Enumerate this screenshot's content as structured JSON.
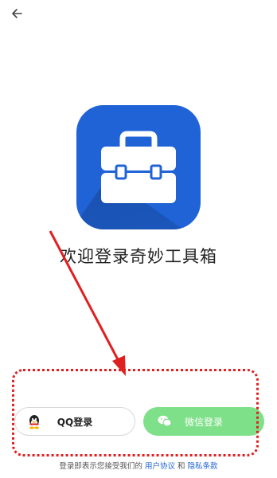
{
  "header": {
    "back_icon": "arrow-left-icon"
  },
  "app": {
    "icon": "toolbox-icon",
    "icon_bg": "#1f63d6"
  },
  "welcome_title": "欢迎登录奇妙工具箱",
  "login": {
    "qq_label": "QQ登录",
    "qq_icon": "qq-penguin-icon",
    "wechat_label": "微信登录",
    "wechat_icon": "wechat-icon",
    "wechat_color": "#7fe08a"
  },
  "agreement": {
    "prefix": "登录即表示您接受我们的",
    "user_agreement": "用户协议",
    "and": "和",
    "privacy_policy": "隐私条款"
  },
  "annotation": {
    "color": "#e02020"
  }
}
